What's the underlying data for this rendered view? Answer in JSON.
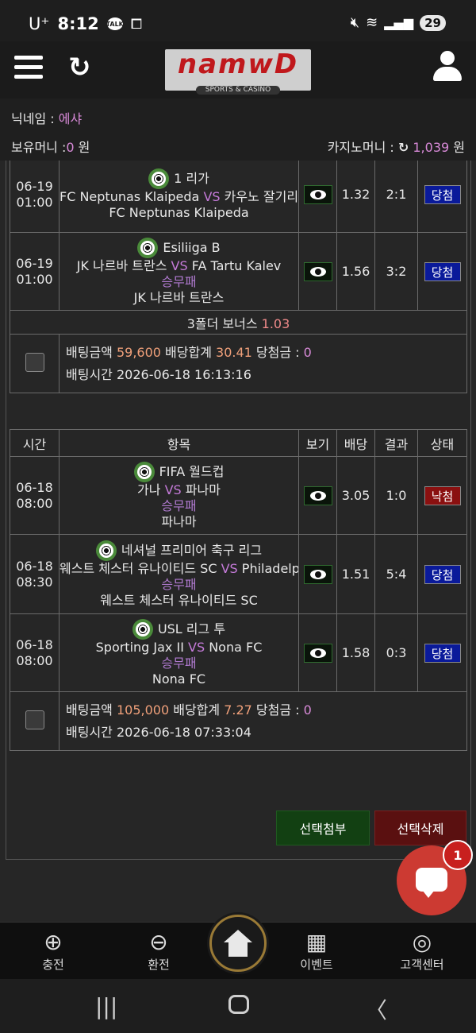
{
  "status_bar": {
    "carrier": "U⁺",
    "time": "8:12",
    "talk_label": "TALK",
    "battery": "29"
  },
  "header": {
    "logo_text": "namwD",
    "logo_sub": "SPORTS & CASINO"
  },
  "info": {
    "nickname_label": "닉네임 : ",
    "nickname_value": "에샤",
    "money_label": "보유머니 :",
    "money_value": "0",
    "money_unit": " 원",
    "casino_label": "카지노머니 : ",
    "casino_value": "1,039",
    "casino_unit": " 원"
  },
  "slip1": {
    "rows": [
      {
        "date": "06-19",
        "time": "01:00",
        "league": "1 리가",
        "home": "FC Neptunas Klaipeda",
        "vs": " VS ",
        "away": "카우노 잘기리스",
        "outcome": "",
        "pick": "FC Neptunas Klaipeda",
        "odds": "1.32",
        "result": "2:1",
        "status": "당첨"
      },
      {
        "date": "06-19",
        "time": "01:00",
        "league": "Esiliiga B",
        "home": "JK 나르바 트란스",
        "vs": " VS ",
        "away": "FA Tartu Kalev",
        "outcome": "승무패",
        "pick": "JK 나르바 트란스",
        "odds": "1.56",
        "result": "3:2",
        "status": "당첨"
      }
    ],
    "bonus_label": "3폴더 보너스 ",
    "bonus_value": "1.03",
    "bet_amount_label": "배팅금액 ",
    "bet_amount": "59,600",
    "odds_total_label": " 배당합계 ",
    "odds_total": "30.41",
    "win_label": " 당첨금 : ",
    "win_amount": "0",
    "bet_time_label": "배팅시간 ",
    "bet_time": "2026-06-18 16:13:16"
  },
  "slip2": {
    "headers": {
      "time": "시간",
      "item": "항목",
      "view": "보기",
      "odds": "배당",
      "result": "결과",
      "status": "상태"
    },
    "rows": [
      {
        "date": "06-18",
        "time": "08:00",
        "league": "FIFA 월드컵",
        "home": "가나",
        "vs": " VS ",
        "away": "파나마",
        "outcome": "승무패",
        "pick": "파나마",
        "odds": "3.05",
        "result": "1:0",
        "status": "낙첨"
      },
      {
        "date": "06-18",
        "time": "08:30",
        "league": "네셔널 프리미어 축구 리그",
        "home": "웨스트 체스터 유나이티드 SC",
        "vs": " VS ",
        "away": "Philadelphia",
        "outcome": "승무패",
        "pick": "웨스트 체스터 유나이티드 SC",
        "odds": "1.51",
        "result": "5:4",
        "status": "당첨"
      },
      {
        "date": "06-18",
        "time": "08:00",
        "league": "USL 리그 투",
        "home": "Sporting Jax II",
        "vs": " VS ",
        "away": "Nona FC",
        "outcome": "승무패",
        "pick": "Nona FC",
        "odds": "1.58",
        "result": "0:3",
        "status": "당첨"
      }
    ],
    "bet_amount_label": "배팅금액 ",
    "bet_amount": "105,000",
    "odds_total_label": " 배당합계 ",
    "odds_total": "7.27",
    "win_label": " 당첨금 : ",
    "win_amount": "0",
    "bet_time_label": "배팅시간 ",
    "bet_time": "2026-06-18 07:33:04"
  },
  "actions": {
    "attach": "선택첨부",
    "delete": "선택삭제"
  },
  "chat": {
    "badge": "1"
  },
  "bottom_nav": {
    "charge": "충전",
    "exchange": "환전",
    "event": "이벤트",
    "support": "고객센터"
  },
  "colors": {
    "win": "#0a1a9a",
    "lose": "#8a1010",
    "accent_pink": "#d88ad8",
    "odds": "#f08a8a"
  }
}
